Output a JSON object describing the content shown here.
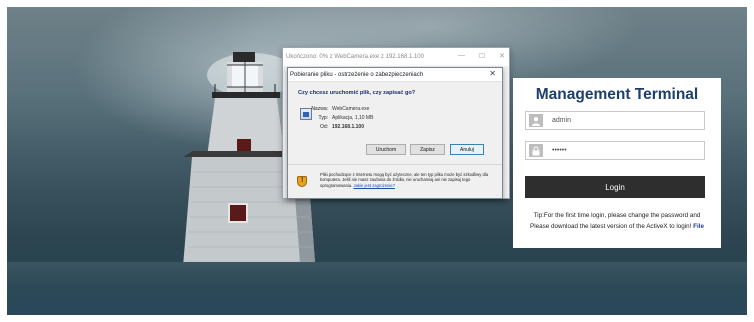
{
  "download_window": {
    "title": "Ukończono: 0% z WebCamera.exe z 192.168.1.100",
    "controls": [
      "—",
      "☐",
      "✕"
    ]
  },
  "security_dialog": {
    "title": "Pobieranie pliku - ostrzeżenie o zabezpieczeniach",
    "question": "Czy chcesz uruchomić plik, czy zapisać go?",
    "file_name_label": "Nazwa:",
    "file_name": "WebCamera.exe",
    "type_label": "Typ:",
    "type_value": "Aplikacja, 1,10 MB",
    "from_label": "Od:",
    "from_value": "192.168.1.100",
    "buttons": {
      "run": "Uruchom",
      "save": "Zapisz",
      "cancel": "Anuluj"
    },
    "footer_text": "Pliki pochodzące z Internetu mogą być użyteczne, ale ten typ pliku może być szkodliwy dla komputera. Jeśli nie masz zaufania do źródła, nie uruchamiaj ani nie zapisuj tego oprogramowania.",
    "footer_link": "Jakie jest zagrożenie?"
  },
  "login": {
    "title": "Management Terminal",
    "username_value": "admin",
    "password_value": "••••••",
    "button": "Login",
    "tip_line1": "Tip:For the first time login, please change the password and",
    "tip_line2": "Please download the latest version of the ActiveX to login!",
    "tip_link": "File",
    "icons": {
      "user": "user-icon",
      "lock": "lock-icon"
    }
  },
  "colors": {
    "title_blue": "#1f3f6b",
    "login_button": "#2e2e2e",
    "link_blue": "#1c3d9b"
  }
}
